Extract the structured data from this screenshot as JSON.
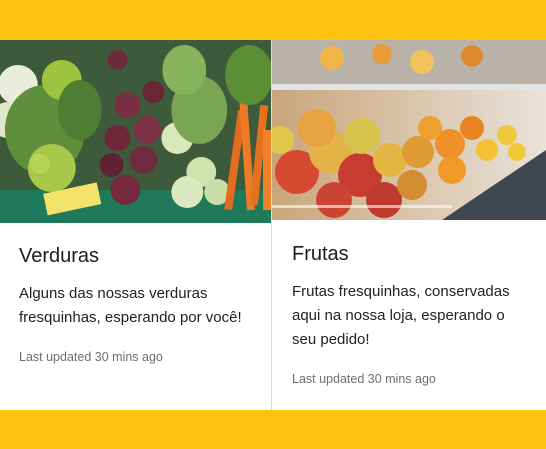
{
  "cards": [
    {
      "title": "Verduras",
      "text": "Alguns das nossas verduras fresquinhas, esperando por você!",
      "updated": "Last updated 30 mins ago",
      "image": "vegetables-photo"
    },
    {
      "title": "Frutas",
      "text": "Frutas fresquinhas, conservadas aqui na nossa loja, esperando o seu pedido!",
      "updated": "Last updated 30 mins ago",
      "image": "fruits-photo"
    }
  ],
  "colors": {
    "band": "#ffc20e",
    "card_bg": "#ffffff",
    "title": "#1c1c1c",
    "muted": "#6e6e6e"
  }
}
